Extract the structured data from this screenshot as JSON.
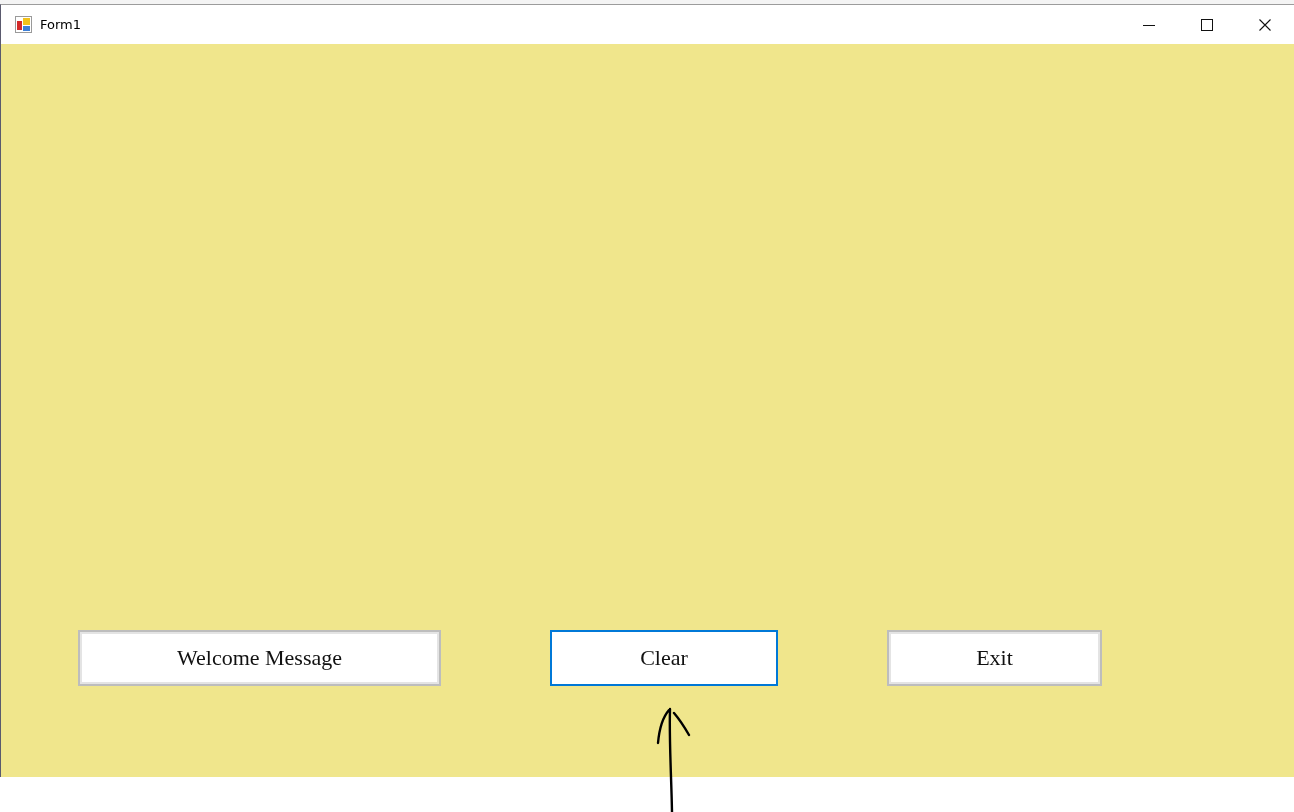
{
  "window": {
    "title": "Form1",
    "controls": [
      {
        "kind": "minimize"
      },
      {
        "kind": "maximize"
      },
      {
        "kind": "close"
      }
    ]
  },
  "form": {
    "buttons": [
      {
        "label": "Welcome Message",
        "focused": false
      },
      {
        "label": "Clear",
        "focused": true
      },
      {
        "label": "Exit",
        "focused": false
      }
    ]
  },
  "annotations": [
    {
      "kind": "arrow"
    }
  ]
}
